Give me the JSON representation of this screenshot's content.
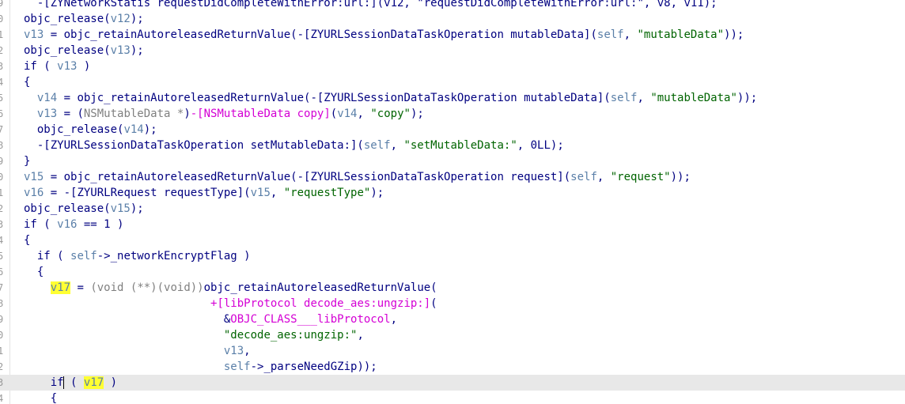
{
  "editor": {
    "lines": [
      {
        "num": "9",
        "current": false,
        "spans": [
          {
            "c": "t-blue",
            "t": "  -[ZYNetworkStatis requestDidCompleteWithError:url:](v12, \"requestDidCompleteWithError:url:\", v8, v11);"
          }
        ]
      },
      {
        "num": "0",
        "current": false,
        "spans": [
          {
            "c": "t-blue",
            "t": "objc_release("
          },
          {
            "c": "t-var",
            "t": "v12"
          },
          {
            "c": "t-blue",
            "t": ");"
          }
        ]
      },
      {
        "num": "1",
        "current": false,
        "spans": [
          {
            "c": "t-var",
            "t": "v13"
          },
          {
            "c": "t-blue",
            "t": " = objc_retainAutoreleasedReturnValue(-[ZYURLSessionDataTaskOperation mutableData]("
          },
          {
            "c": "t-var",
            "t": "self"
          },
          {
            "c": "t-blue",
            "t": ", "
          },
          {
            "c": "t-str",
            "t": "\"mutableData\""
          },
          {
            "c": "t-blue",
            "t": "));"
          }
        ]
      },
      {
        "num": "2",
        "current": false,
        "spans": [
          {
            "c": "t-blue",
            "t": "objc_release("
          },
          {
            "c": "t-var",
            "t": "v13"
          },
          {
            "c": "t-blue",
            "t": ");"
          }
        ]
      },
      {
        "num": "3",
        "current": false,
        "spans": [
          {
            "c": "t-blue",
            "t": "if ( "
          },
          {
            "c": "t-var",
            "t": "v13"
          },
          {
            "c": "t-blue",
            "t": " )"
          }
        ]
      },
      {
        "num": "4",
        "current": false,
        "spans": [
          {
            "c": "t-blue",
            "t": "{"
          }
        ]
      },
      {
        "num": "5",
        "current": false,
        "spans": [
          {
            "c": "t-blue",
            "t": "  "
          },
          {
            "c": "t-var",
            "t": "v14"
          },
          {
            "c": "t-blue",
            "t": " = objc_retainAutoreleasedReturnValue(-[ZYURLSessionDataTaskOperation mutableData]("
          },
          {
            "c": "t-var",
            "t": "self"
          },
          {
            "c": "t-blue",
            "t": ", "
          },
          {
            "c": "t-str",
            "t": "\"mutableData\""
          },
          {
            "c": "t-blue",
            "t": "));"
          }
        ]
      },
      {
        "num": "6",
        "current": false,
        "spans": [
          {
            "c": "t-blue",
            "t": "  "
          },
          {
            "c": "t-var",
            "t": "v13"
          },
          {
            "c": "t-blue",
            "t": " = ("
          },
          {
            "c": "t-gray",
            "t": "NSMutableData *"
          },
          {
            "c": "t-blue",
            "t": ")"
          },
          {
            "c": "t-pink",
            "t": "-[NSMutableData copy]"
          },
          {
            "c": "t-blue",
            "t": "("
          },
          {
            "c": "t-var",
            "t": "v14"
          },
          {
            "c": "t-blue",
            "t": ", "
          },
          {
            "c": "t-str",
            "t": "\"copy\""
          },
          {
            "c": "t-blue",
            "t": ");"
          }
        ]
      },
      {
        "num": "7",
        "current": false,
        "spans": [
          {
            "c": "t-blue",
            "t": "  objc_release("
          },
          {
            "c": "t-var",
            "t": "v14"
          },
          {
            "c": "t-blue",
            "t": ");"
          }
        ]
      },
      {
        "num": "8",
        "current": false,
        "spans": [
          {
            "c": "t-blue",
            "t": "  -[ZYURLSessionDataTaskOperation setMutableData:]("
          },
          {
            "c": "t-var",
            "t": "self"
          },
          {
            "c": "t-blue",
            "t": ", "
          },
          {
            "c": "t-str",
            "t": "\"setMutableData:\""
          },
          {
            "c": "t-blue",
            "t": ", 0LL);"
          }
        ]
      },
      {
        "num": "9",
        "current": false,
        "spans": [
          {
            "c": "t-blue",
            "t": "}"
          }
        ]
      },
      {
        "num": "0",
        "current": false,
        "spans": [
          {
            "c": "t-var",
            "t": "v15"
          },
          {
            "c": "t-blue",
            "t": " = objc_retainAutoreleasedReturnValue(-[ZYURLSessionDataTaskOperation request]("
          },
          {
            "c": "t-var",
            "t": "self"
          },
          {
            "c": "t-blue",
            "t": ", "
          },
          {
            "c": "t-str",
            "t": "\"request\""
          },
          {
            "c": "t-blue",
            "t": "));"
          }
        ]
      },
      {
        "num": "1",
        "current": false,
        "spans": [
          {
            "c": "t-var",
            "t": "v16"
          },
          {
            "c": "t-blue",
            "t": " = -[ZYURLRequest requestType]("
          },
          {
            "c": "t-var",
            "t": "v15"
          },
          {
            "c": "t-blue",
            "t": ", "
          },
          {
            "c": "t-str",
            "t": "\"requestType\""
          },
          {
            "c": "t-blue",
            "t": ");"
          }
        ]
      },
      {
        "num": "2",
        "current": false,
        "spans": [
          {
            "c": "t-blue",
            "t": "objc_release("
          },
          {
            "c": "t-var",
            "t": "v15"
          },
          {
            "c": "t-blue",
            "t": ");"
          }
        ]
      },
      {
        "num": "3",
        "current": false,
        "spans": [
          {
            "c": "t-blue",
            "t": "if ( "
          },
          {
            "c": "t-var",
            "t": "v16"
          },
          {
            "c": "t-blue",
            "t": " == 1 )"
          }
        ]
      },
      {
        "num": "4",
        "current": false,
        "spans": [
          {
            "c": "t-blue",
            "t": "{"
          }
        ]
      },
      {
        "num": "5",
        "current": false,
        "spans": [
          {
            "c": "t-blue",
            "t": "  if ( "
          },
          {
            "c": "t-var",
            "t": "self"
          },
          {
            "c": "t-blue",
            "t": "->_networkEncryptFlag )"
          }
        ]
      },
      {
        "num": "6",
        "current": false,
        "spans": [
          {
            "c": "t-blue",
            "t": "  {"
          }
        ]
      },
      {
        "num": "7",
        "current": false,
        "spans": [
          {
            "c": "t-blue",
            "t": "    "
          },
          {
            "c": "t-hl",
            "t": "v17"
          },
          {
            "c": "t-blue",
            "t": " = "
          },
          {
            "c": "t-gray",
            "t": "(void (**)(void))"
          },
          {
            "c": "t-blue",
            "t": "objc_retainAutoreleasedReturnValue("
          }
        ]
      },
      {
        "num": "8",
        "current": false,
        "spans": [
          {
            "c": "t-blue",
            "t": "                            "
          },
          {
            "c": "t-pink",
            "t": "+[libProtocol decode_aes:ungzip:]"
          },
          {
            "c": "t-blue",
            "t": "("
          }
        ]
      },
      {
        "num": "9",
        "current": false,
        "spans": [
          {
            "c": "t-blue",
            "t": "                              &"
          },
          {
            "c": "t-pink",
            "t": "OBJC_CLASS___libProtocol"
          },
          {
            "c": "t-blue",
            "t": ","
          }
        ]
      },
      {
        "num": "0",
        "current": false,
        "spans": [
          {
            "c": "t-blue",
            "t": "                              "
          },
          {
            "c": "t-str",
            "t": "\"decode_aes:ungzip:\""
          },
          {
            "c": "t-blue",
            "t": ","
          }
        ]
      },
      {
        "num": "1",
        "current": false,
        "spans": [
          {
            "c": "t-blue",
            "t": "                              "
          },
          {
            "c": "t-var",
            "t": "v13"
          },
          {
            "c": "t-blue",
            "t": ","
          }
        ]
      },
      {
        "num": "2",
        "current": false,
        "spans": [
          {
            "c": "t-blue",
            "t": "                              "
          },
          {
            "c": "t-var",
            "t": "self"
          },
          {
            "c": "t-blue",
            "t": "->_parseNeedGZip));"
          }
        ]
      },
      {
        "num": "3",
        "current": true,
        "spans": [
          {
            "c": "t-blue",
            "t": "    if"
          },
          {
            "c": "caret",
            "t": ""
          },
          {
            "c": "t-blue",
            "t": " ( "
          },
          {
            "c": "t-hl",
            "t": "v17"
          },
          {
            "c": "t-blue",
            "t": " )"
          }
        ]
      },
      {
        "num": "4",
        "current": false,
        "spans": [
          {
            "c": "t-blue",
            "t": "    {"
          }
        ]
      }
    ]
  },
  "colors": {
    "background": "#ffffff",
    "identifier": "#000080",
    "variable": "#5a7fa8",
    "string": "#006400",
    "pink": "#d400d4",
    "highlight": "#ffff33",
    "current_line": "#e8e8e8"
  }
}
